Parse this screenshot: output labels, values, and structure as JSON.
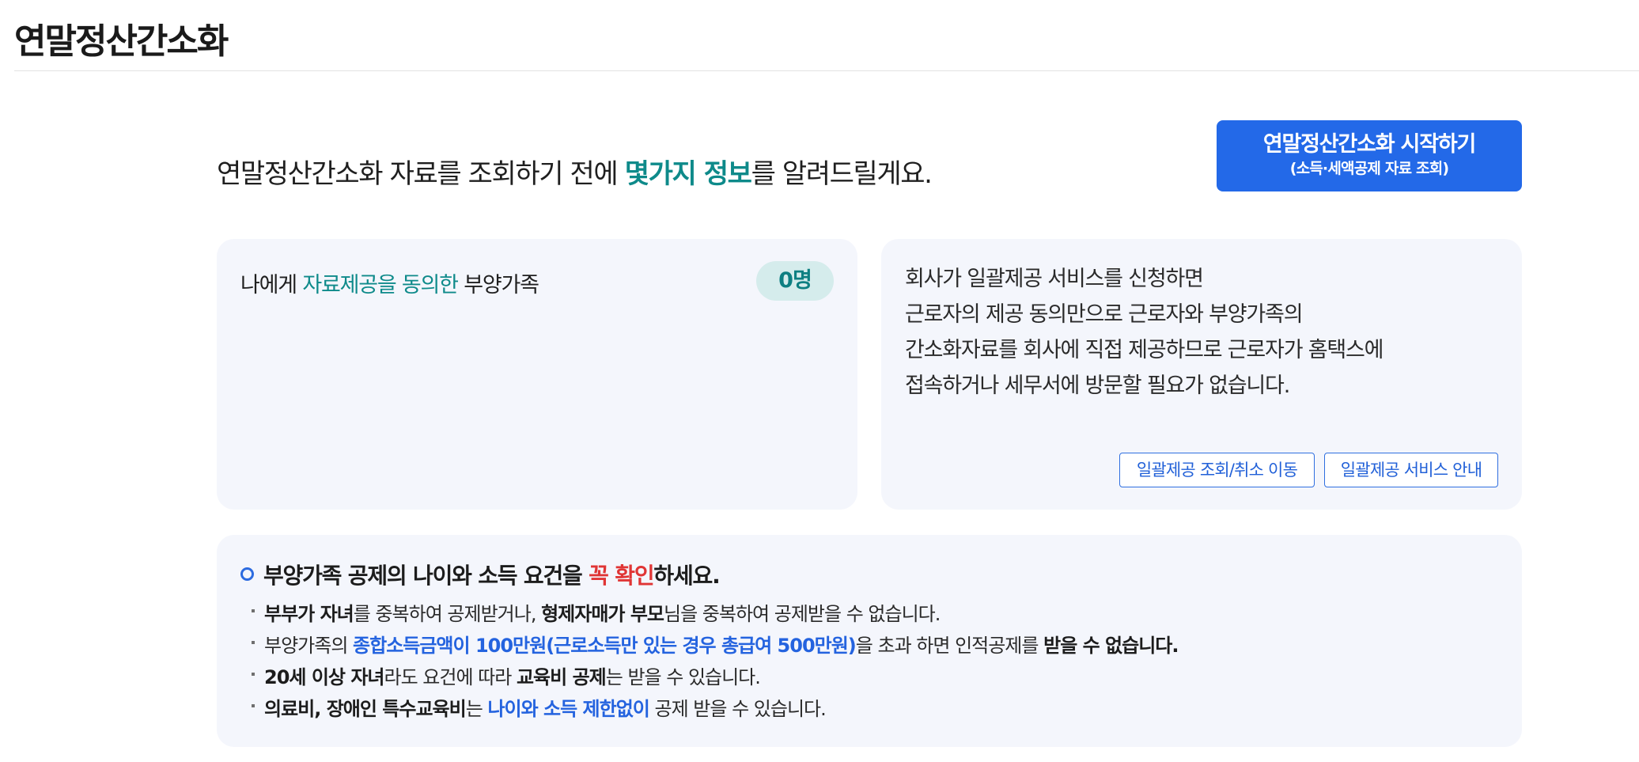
{
  "page": {
    "title": "연말정산간소화"
  },
  "intro": {
    "before": "연말정산간소화 자료를 조회하기 전에 ",
    "highlight": "몇가지 정보",
    "after": "를 알려드릴게요."
  },
  "start_button": {
    "label": "연말정산간소화 시작하기",
    "sublabel": "(소득·세액공제 자료 조회)"
  },
  "consent_card": {
    "label_before": "나에게 ",
    "label_highlight": "자료제공을 동의한",
    "label_after": " 부양가족",
    "count": "0명"
  },
  "bulk_card": {
    "lines": [
      "회사가 일괄제공 서비스를 신청하면",
      "근로자의 제공 동의만으로 근로자와 부양가족의",
      "간소화자료를 회사에 직접 제공하므로 근로자가 홈택스에",
      "접속하거나 세무서에 방문할 필요가 없습니다."
    ],
    "buttons": {
      "lookup_label": "일괄제공 조회/취소 이동",
      "guide_label": "일괄제공 서비스 안내"
    }
  },
  "requirements": {
    "heading_before": "부양가족 공제의 나이와 소득 요건을 ",
    "heading_highlight": "꼭 확인",
    "heading_after": "하세요.",
    "items": [
      {
        "p1": "부부가 자녀",
        "p2": "를 중복하여 공제받거나, ",
        "p3": "형제자매가 부모",
        "p4": "님을 중복하여 공제받을 수 없습니다."
      },
      {
        "p1": "부양가족의 ",
        "p2": "종합소득금액이 100만원(근로소득만 있는 경우 총급여 500만원)",
        "p3": "을 초과 하면 인적공제를 ",
        "p4": "받을 수 없습니다."
      },
      {
        "p1": "20세 이상 자녀",
        "p2": "라도 요건에 따라 ",
        "p3": "교육비 공제",
        "p4": "는 받을 수 있습니다."
      },
      {
        "p1": "의료비, 장애인 특수교육비",
        "p2": "는 ",
        "p3": "나이와 소득 제한없이",
        "p4": " 공제 받을 수 있습니다."
      }
    ]
  },
  "colors": {
    "accent_teal": "#0e8a8a",
    "primary_blue": "#2369e8",
    "warning_red": "#e03535",
    "card_bg": "#f4f6fc"
  }
}
